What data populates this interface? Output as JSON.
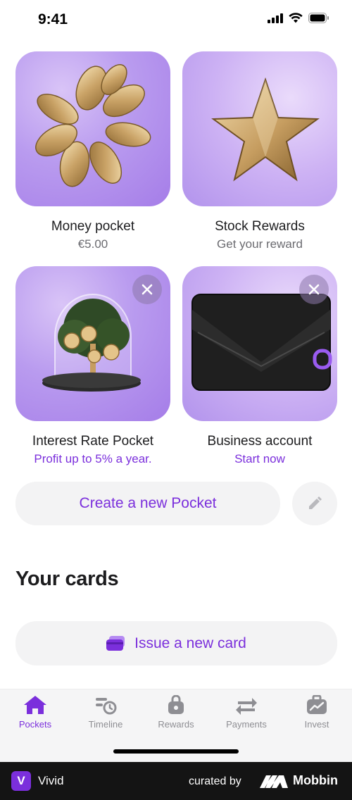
{
  "status_bar": {
    "time": "9:41"
  },
  "pockets": [
    {
      "title": "Money pocket",
      "subtitle": "€5.00",
      "subtitle_style": "gray",
      "closable": false,
      "art": "coins-ring"
    },
    {
      "title": "Stock Rewards",
      "subtitle": "Get your reward",
      "subtitle_style": "gray",
      "closable": false,
      "art": "gold-star"
    },
    {
      "title": "Interest Rate Pocket",
      "subtitle": "Profit up to 5% a year.",
      "subtitle_style": "purple",
      "closable": true,
      "art": "money-tree-dome"
    },
    {
      "title": "Business account",
      "subtitle": "Start now",
      "subtitle_style": "purple",
      "closable": true,
      "art": "black-wallet"
    }
  ],
  "create_pocket": {
    "label": "Create a new Pocket",
    "edit_icon": "pencil-icon"
  },
  "cards_section": {
    "title": "Your cards",
    "issue_label": "Issue a new card",
    "issue_icon": "card-icon"
  },
  "tabbar": {
    "items": [
      {
        "label": "Pockets",
        "icon": "home-icon",
        "active": true
      },
      {
        "label": "Timeline",
        "icon": "timeline-icon",
        "active": false
      },
      {
        "label": "Rewards",
        "icon": "bag-icon",
        "active": false
      },
      {
        "label": "Payments",
        "icon": "transfer-icon",
        "active": false
      },
      {
        "label": "Invest",
        "icon": "briefcase-chart-icon",
        "active": false
      }
    ]
  },
  "footer": {
    "app_logo_letter": "V",
    "app_name": "Vivid",
    "curated_by": "curated by",
    "brand": "Mobbin"
  },
  "colors": {
    "accent": "#7b2fdc",
    "tile_purple": "#b99bef",
    "pill_bg": "#f3f3f4",
    "inactive": "#8e8e93"
  }
}
